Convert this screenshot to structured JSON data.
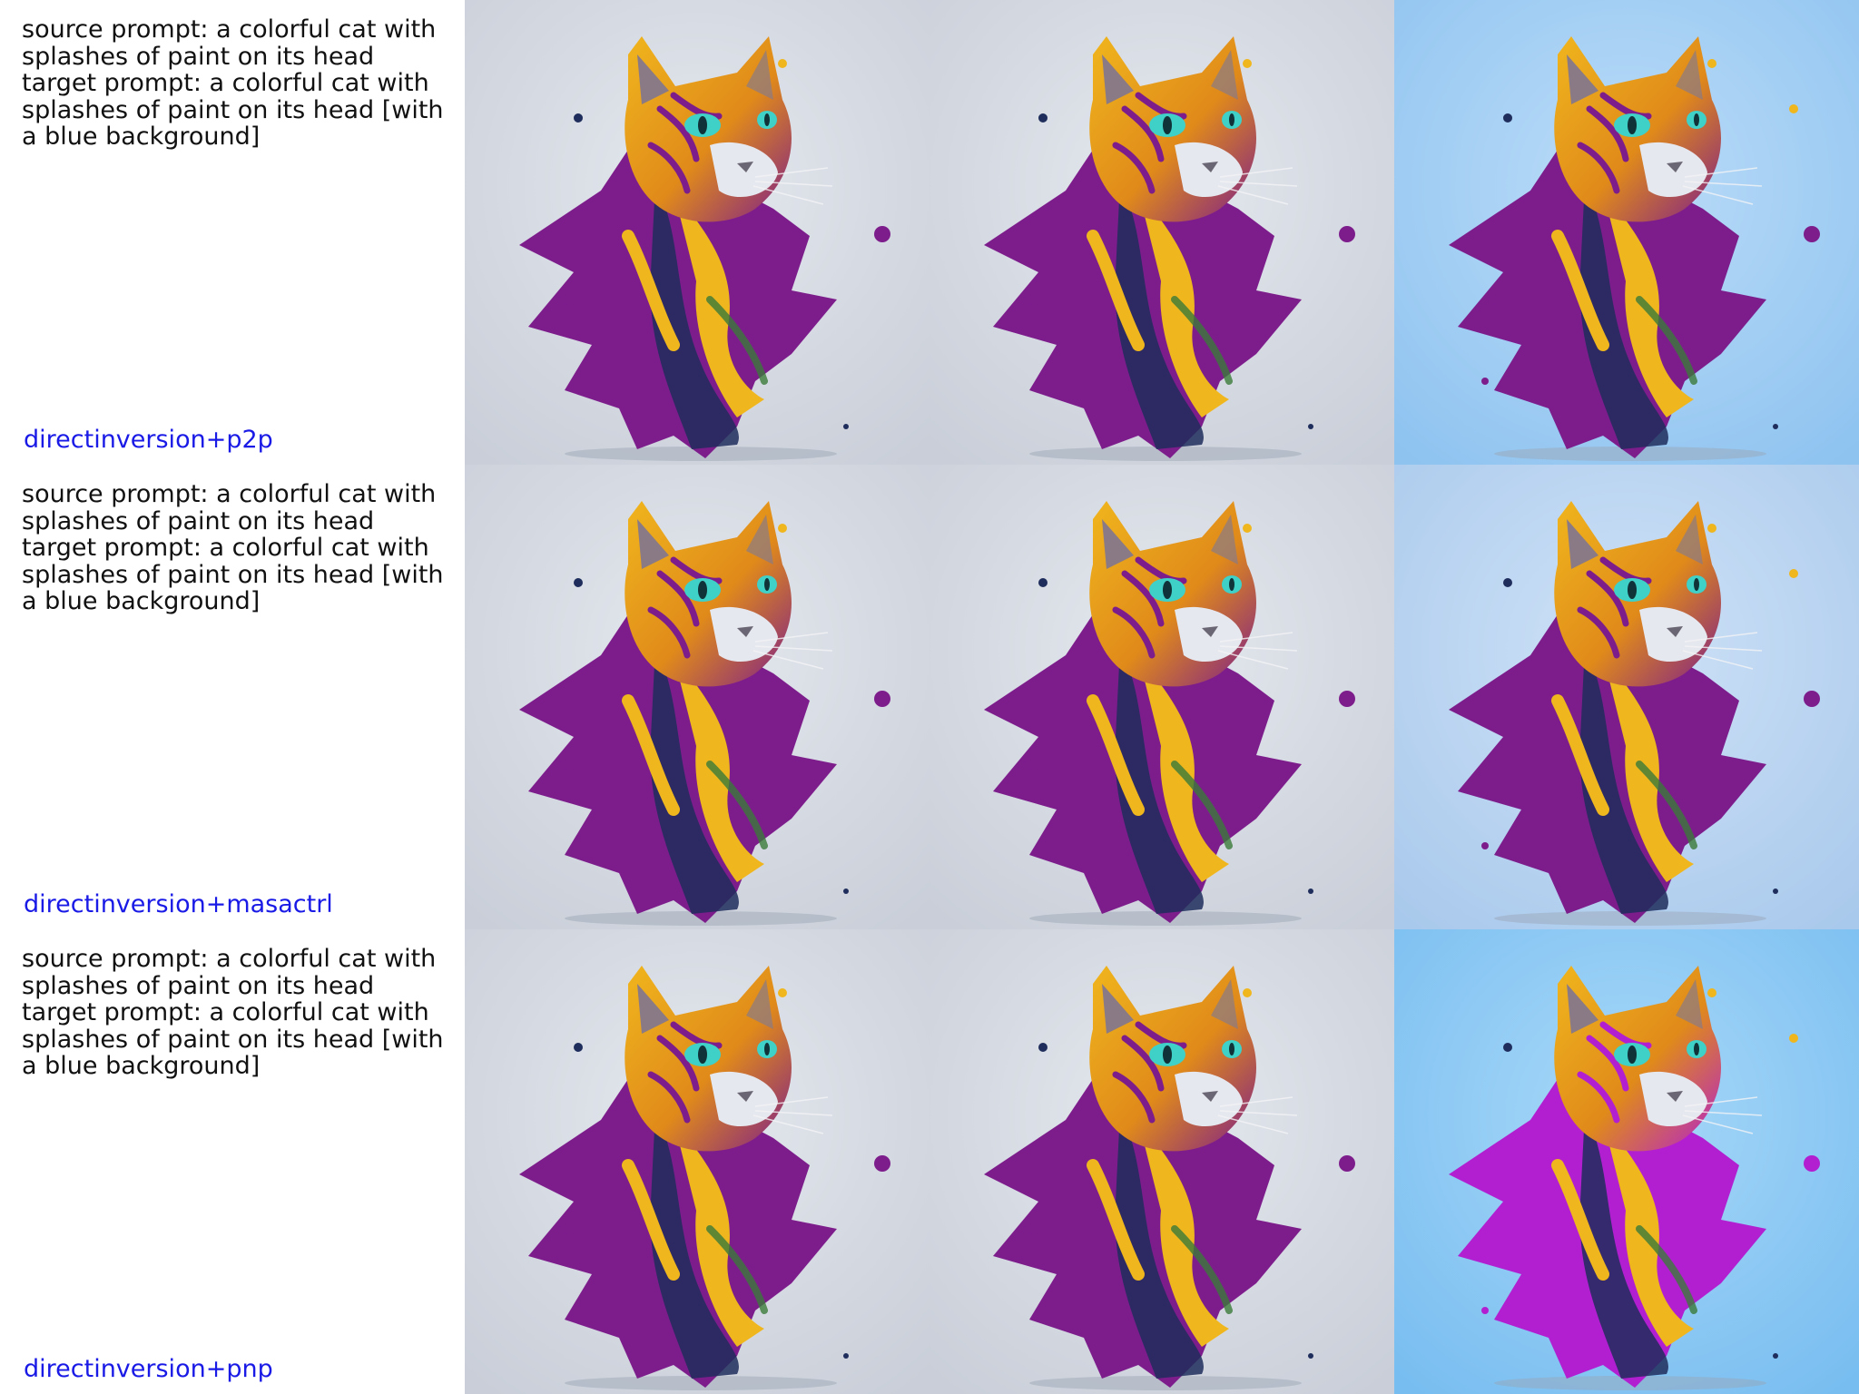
{
  "colors": {
    "method_label": "#1a1ae6",
    "prompt_text": "#111111",
    "gray_bg": "#d6dbe3",
    "blue_bg_light": "#b5d4f3",
    "blue_bg_strong": "#8cc6f2",
    "paint_purple": "#7d1d8c",
    "paint_yellow": "#f0b61d",
    "paint_navy": "#1f2d5c",
    "eye_cyan": "#3fd0c8"
  },
  "rows": [
    {
      "source_prompt": "source prompt: a colorful cat with splashes of paint on its head",
      "target_prompt": "target prompt: a colorful cat with splashes of paint on its head [with a blue background]",
      "method": "directinversion+p2p",
      "tiles": [
        {
          "role": "source",
          "background": "gray",
          "icon": "cat-paint-splash-image"
        },
        {
          "role": "reconstruction",
          "background": "gray",
          "icon": "cat-paint-splash-image"
        },
        {
          "role": "edited",
          "background": "blue",
          "icon": "cat-paint-splash-image"
        }
      ]
    },
    {
      "source_prompt": "source prompt: a colorful cat with splashes of paint on its head",
      "target_prompt": "target prompt: a colorful cat with splashes of paint on its head [with a blue background]",
      "method": "directinversion+masactrl",
      "tiles": [
        {
          "role": "source",
          "background": "gray",
          "icon": "cat-paint-splash-image"
        },
        {
          "role": "reconstruction",
          "background": "gray",
          "icon": "cat-paint-splash-image"
        },
        {
          "role": "edited",
          "background": "blue",
          "icon": "cat-paint-splash-image"
        }
      ]
    },
    {
      "source_prompt": "source prompt: a colorful cat with splashes of paint on its head",
      "target_prompt": "target prompt: a colorful cat with splashes of paint on its head [with a blue background]",
      "method": "directinversion+pnp",
      "tiles": [
        {
          "role": "source",
          "background": "gray",
          "icon": "cat-paint-splash-image"
        },
        {
          "role": "reconstruction",
          "background": "gray",
          "icon": "cat-paint-splash-image"
        },
        {
          "role": "edited",
          "background": "blue",
          "icon": "cat-paint-splash-image"
        }
      ]
    }
  ]
}
